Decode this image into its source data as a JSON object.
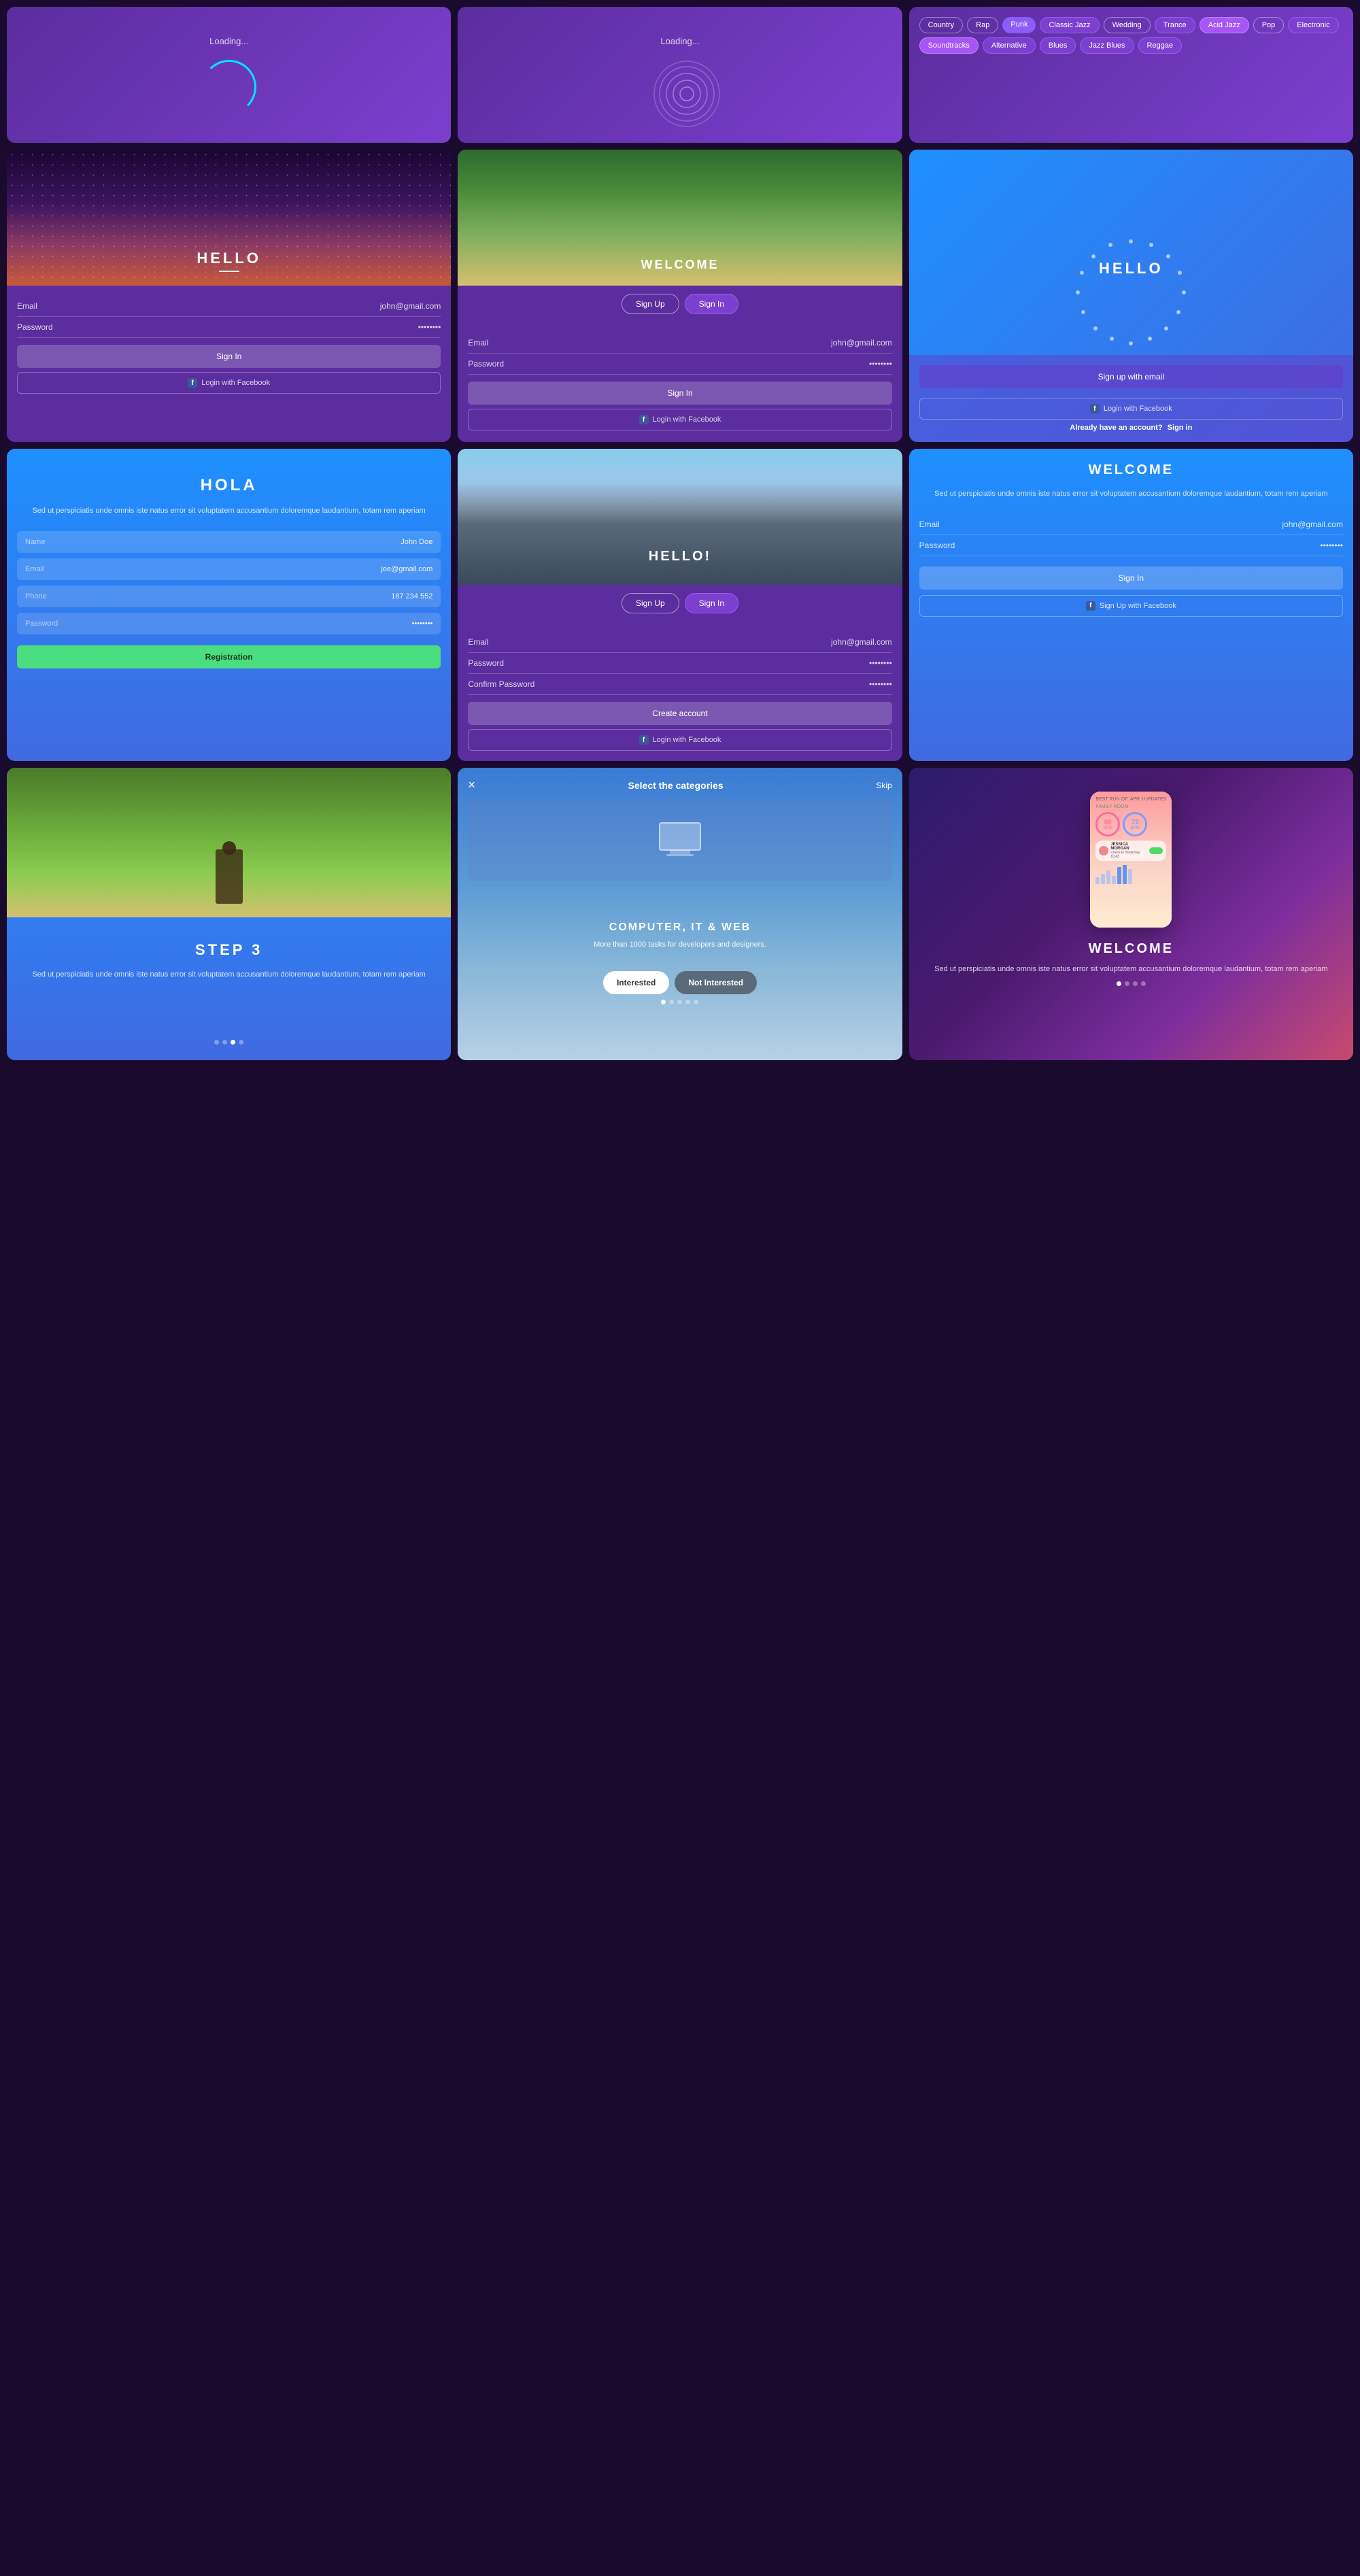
{
  "cards": {
    "loading1": {
      "text": "Loading..."
    },
    "loading2": {
      "text": "Loading..."
    },
    "genres": {
      "tags": [
        {
          "label": "Country",
          "style": "outline"
        },
        {
          "label": "Rap",
          "style": "outline"
        },
        {
          "label": "Punk",
          "style": "punk"
        },
        {
          "label": "Classic Jazz",
          "style": "active"
        },
        {
          "label": "Wedding",
          "style": "outline"
        },
        {
          "label": "Trance",
          "style": "active"
        },
        {
          "label": "Acid Jazz",
          "style": "highlighted"
        },
        {
          "label": "Pop",
          "style": "outline"
        },
        {
          "label": "Electronic",
          "style": "active"
        },
        {
          "label": "Soundtracks",
          "style": "highlighted"
        },
        {
          "label": "Alternative",
          "style": "active"
        },
        {
          "label": "Blues",
          "style": "active"
        },
        {
          "label": "Jazz Blues",
          "style": "active"
        },
        {
          "label": "Reggae",
          "style": "active"
        }
      ]
    },
    "hello_dark": {
      "title": "HELLO",
      "email_label": "Email",
      "email_value": "john@gmail.com",
      "password_label": "Password",
      "password_value": "••••••••",
      "sign_in_btn": "Sign In",
      "facebook_btn": "Login with Facebook"
    },
    "welcome_outdoor": {
      "title": "WELCOME",
      "tab_signup": "Sign Up",
      "tab_signin": "Sign In",
      "email_label": "Email",
      "email_value": "john@gmail.com",
      "password_label": "Password",
      "password_value": "••••••••",
      "sign_in_btn": "Sign In",
      "facebook_btn": "Login with Facebook"
    },
    "hello_blue": {
      "title": "HELLO",
      "signup_email_btn": "Sign up with email",
      "login_facebook_btn": "Login with Facebook",
      "already_account": "Already have an account?",
      "sign_in_link": "Sign in"
    },
    "hola": {
      "title": "HOLA",
      "description": "Sed ut perspiciatis unde omnis iste natus error sit voluptatem accusantium doloremque laudantium, totam rem aperiam",
      "name_label": "Name",
      "name_value": "John Doe",
      "email_label": "Email",
      "email_value": "joe@gmail.com",
      "phone_label": "Phone",
      "phone_value": "187 234 552",
      "password_label": "Password",
      "password_value": "••••••••",
      "register_btn": "Registration"
    },
    "hello_city": {
      "title": "HELLO!",
      "tab_signup": "Sign Up",
      "tab_signin": "Sign In",
      "email_label": "Email",
      "email_value": "john@gmail.com",
      "password_label": "Password",
      "password_value": "••••••••",
      "confirm_label": "Confirm Password",
      "confirm_value": "••••••••",
      "create_btn": "Create account",
      "facebook_btn": "Login with Facebook"
    },
    "welcome_blue": {
      "title": "WELCOME",
      "description": "Sed ut perspiciatis unde omnis iste natus error sit voluptatem accusantium doloremque laudantium, totam rem aperiam",
      "email_label": "Email",
      "email_value": "john@gmail.com",
      "password_label": "Password",
      "password_value": "••••••••",
      "sign_in_btn": "Sign In",
      "facebook_btn": "Sign Up with Facebook"
    },
    "step3": {
      "title": "STEP 3",
      "description": "Sed ut perspiciatis unde omnis iste natus error sit voluptatem accusantium doloremque laudantium, totam rem aperiam",
      "dots": [
        false,
        false,
        true,
        false
      ]
    },
    "categories": {
      "close_icon": "×",
      "title": "Select the categories",
      "skip_btn": "Skip",
      "category_title": "COMPUTER, IT & WEB",
      "category_desc": "More than 1000 tasks for developers and designers.",
      "interested_btn": "Interested",
      "not_interested_btn": "Not Interested",
      "dots": [
        true,
        false,
        false,
        false,
        false
      ]
    },
    "welcome_app": {
      "title": "WELCOME",
      "description": "Sed ut perspiciatis unde omnis iste natus error sit voluptatem accusantium doloremque laudantium, totam rem aperiam",
      "dots": [
        true,
        false,
        false,
        false
      ],
      "stat1_value": "68",
      "stat1_label": "BPM",
      "stat2_value": "72",
      "stat2_label": "BPM"
    }
  }
}
